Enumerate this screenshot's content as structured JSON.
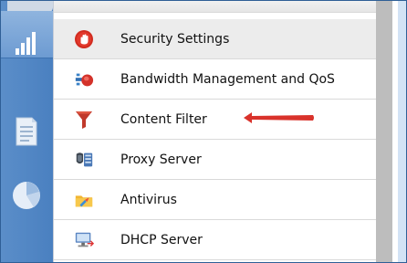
{
  "menu": {
    "items": [
      {
        "label": "Security Settings",
        "icon": "hand-stop-icon",
        "highlighted": true
      },
      {
        "label": "Bandwidth Management and QoS",
        "icon": "bandwidth-qos-icon",
        "highlighted": false
      },
      {
        "label": "Content Filter",
        "icon": "funnel-filter-icon",
        "highlighted": false
      },
      {
        "label": "Proxy Server",
        "icon": "proxy-server-icon",
        "highlighted": false
      },
      {
        "label": "Antivirus",
        "icon": "antivirus-folder-icon",
        "highlighted": false
      },
      {
        "label": "DHCP Server",
        "icon": "dhcp-server-icon",
        "highlighted": false
      }
    ]
  },
  "rail": {
    "icons": [
      "signal-bars-icon",
      "document-icon",
      "pie-chart-icon"
    ]
  },
  "annotation": {
    "icon": "red-arrow-pointer-icon",
    "points_to": "Content Filter"
  },
  "colors": {
    "rail": "#4a80c0",
    "highlight_row": "#ececec",
    "scrollbar": "#bdbdbd",
    "arrow": "#d9322b",
    "filter_icon": "#c0392b"
  }
}
